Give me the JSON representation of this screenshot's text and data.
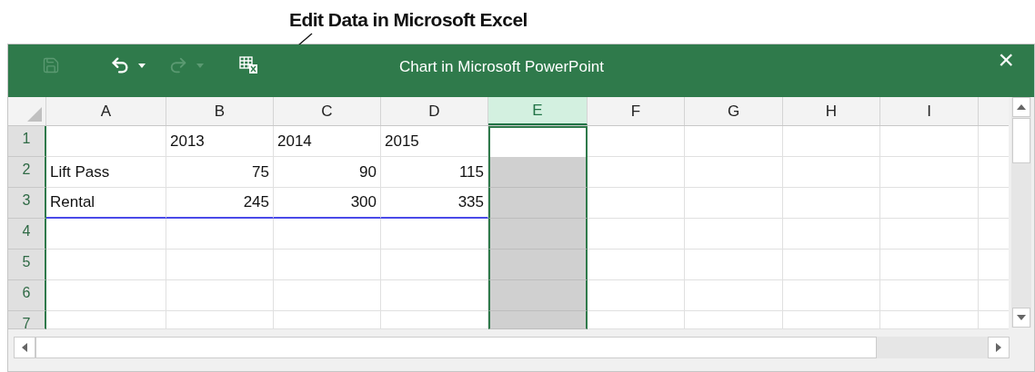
{
  "annotation": {
    "text": "Edit Data in Microsoft Excel"
  },
  "toolbar": [
    {
      "kind": "save",
      "disabled": true
    },
    {
      "kind": "undo",
      "disabled": false
    },
    {
      "kind": "caret",
      "disabled": false
    },
    {
      "kind": "redo",
      "disabled": true
    },
    {
      "kind": "caret",
      "disabled": true
    },
    {
      "kind": "edit-data",
      "disabled": false
    }
  ],
  "window": {
    "title": "Chart in Microsoft PowerPoint",
    "close": "×"
  },
  "columns": [
    {
      "label": "A",
      "selected": false
    },
    {
      "label": "B",
      "selected": false
    },
    {
      "label": "C",
      "selected": false
    },
    {
      "label": "D",
      "selected": false
    },
    {
      "label": "E",
      "selected": true
    },
    {
      "label": "F",
      "selected": false
    },
    {
      "label": "G",
      "selected": false
    },
    {
      "label": "H",
      "selected": false
    },
    {
      "label": "I",
      "selected": false
    }
  ],
  "rows": [
    {
      "number": "1",
      "active": true,
      "cells": [
        {
          "kind": "empty"
        },
        {
          "kind": "text",
          "text": "2013"
        },
        {
          "kind": "text",
          "text": "2014"
        },
        {
          "kind": "text",
          "text": "2015"
        }
      ]
    },
    {
      "number": "2",
      "active": false,
      "cells": [
        {
          "kind": "text",
          "text": "Lift Pass"
        },
        {
          "kind": "number",
          "text": "75"
        },
        {
          "kind": "number",
          "text": "90"
        },
        {
          "kind": "number",
          "text": "115"
        }
      ]
    },
    {
      "number": "3",
      "active": false,
      "cells": [
        {
          "kind": "text",
          "text": "Rental",
          "range_end": true
        },
        {
          "kind": "number",
          "text": "245",
          "range_end": true
        },
        {
          "kind": "number",
          "text": "300",
          "range_end": true
        },
        {
          "kind": "number",
          "text": "335",
          "range_end": true
        }
      ]
    },
    {
      "number": "4",
      "active": false,
      "cells": []
    },
    {
      "number": "5",
      "active": false,
      "cells": []
    },
    {
      "number": "6",
      "active": false,
      "cells": []
    },
    {
      "number": "7",
      "active": false,
      "partial": true,
      "cells": []
    }
  ]
}
